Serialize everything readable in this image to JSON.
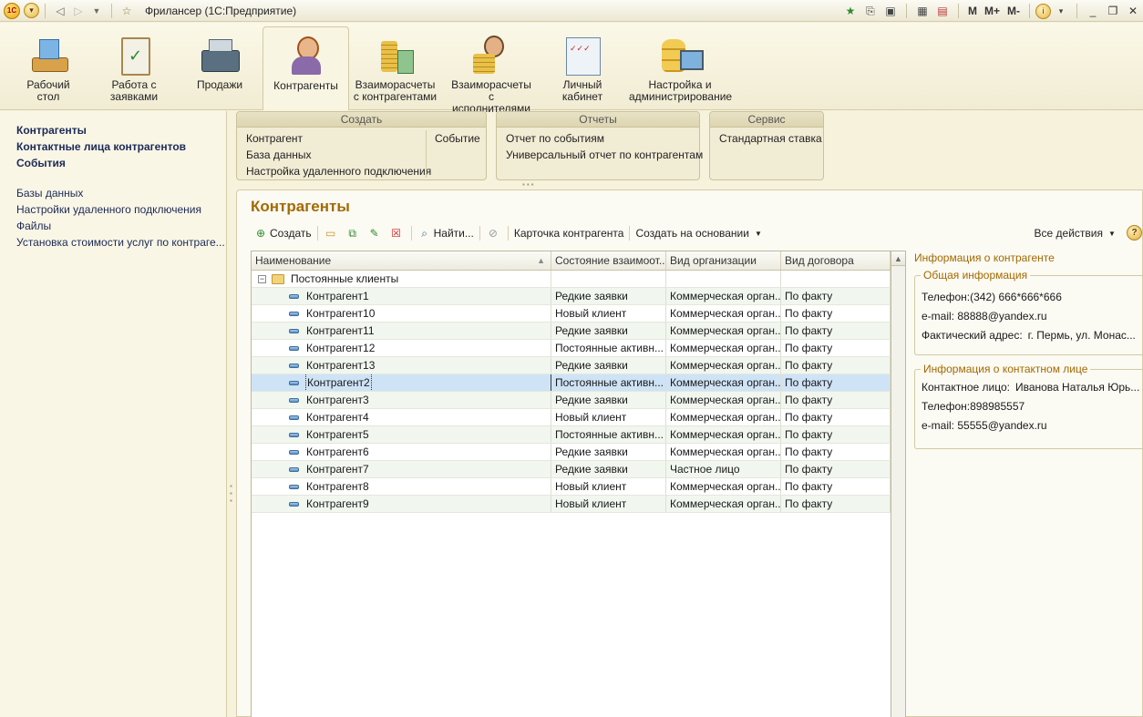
{
  "window": {
    "title": "Фрилансер  (1С:Предприятие)",
    "logo_text": "1С",
    "memory_buttons": [
      "M",
      "M+",
      "M-"
    ]
  },
  "sections": [
    {
      "label_line1": "Рабочий",
      "label_line2": "стол",
      "icon": "desktop-icon"
    },
    {
      "label_line1": "Работа с",
      "label_line2": "заявками",
      "icon": "clipboard-icon"
    },
    {
      "label_line1": "Продажи",
      "label_line2": "",
      "icon": "cash-register-icon"
    },
    {
      "label_line1": "Контрагенты",
      "label_line2": "",
      "icon": "person-icon"
    },
    {
      "label_line1": "Взаиморасчеты",
      "label_line2": "с контрагентами",
      "icon": "coins-icon"
    },
    {
      "label_line1": "Взаиморасчеты",
      "label_line2": "с исполнителями",
      "icon": "worker-icon"
    },
    {
      "label_line1": "Личный",
      "label_line2": "кабинет",
      "icon": "cabinet-icon"
    },
    {
      "label_line1": "Настройка и",
      "label_line2": "администрирование",
      "icon": "database-icon"
    }
  ],
  "leftnav": {
    "main": [
      "Контрагенты",
      "Контактные лица контрагентов",
      "События"
    ],
    "secondary": [
      "Базы данных",
      "Настройки удаленного подключения",
      "Файлы",
      "Установка стоимости услуг по контраге..."
    ]
  },
  "actions": {
    "create": {
      "title": "Создать",
      "items": [
        "Контрагент",
        "База данных",
        "Настройка удаленного подключения"
      ],
      "side_item": "Событие"
    },
    "reports": {
      "title": "Отчеты",
      "items": [
        "Отчет по событиям",
        "Универсальный отчет по контрагентам"
      ]
    },
    "service": {
      "title": "Сервис",
      "items": [
        "Стандартная ставка"
      ]
    }
  },
  "form": {
    "title": "Контрагенты",
    "toolbar": {
      "create": "Создать",
      "find": "Найти...",
      "card": "Карточка контрагента",
      "create_based": "Создать на основании",
      "all_actions": "Все действия",
      "help": "?"
    },
    "table": {
      "columns": [
        "Наименование",
        "Состояние взаимоот...",
        "Вид организации",
        "Вид договора"
      ],
      "group": "Постоянные клиенты",
      "rows": [
        {
          "name": "Контрагент1",
          "state": "Редкие заявки",
          "org": "Коммерческая орган...",
          "contract": "По факту"
        },
        {
          "name": "Контрагент10",
          "state": "Новый клиент",
          "org": "Коммерческая орган...",
          "contract": "По факту"
        },
        {
          "name": "Контрагент11",
          "state": "Редкие заявки",
          "org": "Коммерческая орган...",
          "contract": "По факту"
        },
        {
          "name": "Контрагент12",
          "state": "Постоянные активн...",
          "org": "Коммерческая орган...",
          "contract": "По факту"
        },
        {
          "name": "Контрагент13",
          "state": "Редкие заявки",
          "org": "Коммерческая орган...",
          "contract": "По факту"
        },
        {
          "name": "Контрагент2",
          "state": "Постоянные активн...",
          "org": "Коммерческая орган...",
          "contract": "По факту"
        },
        {
          "name": "Контрагент3",
          "state": "Редкие заявки",
          "org": "Коммерческая орган...",
          "contract": "По факту"
        },
        {
          "name": "Контрагент4",
          "state": "Новый клиент",
          "org": "Коммерческая орган...",
          "contract": "По факту"
        },
        {
          "name": "Контрагент5",
          "state": "Постоянные активн...",
          "org": "Коммерческая орган...",
          "contract": "По факту"
        },
        {
          "name": "Контрагент6",
          "state": "Редкие заявки",
          "org": "Коммерческая орган...",
          "contract": "По факту"
        },
        {
          "name": "Контрагент7",
          "state": "Редкие заявки",
          "org": "Частное лицо",
          "contract": "По факту"
        },
        {
          "name": "Контрагент8",
          "state": "Новый клиент",
          "org": "Коммерческая орган...",
          "contract": "По факту"
        },
        {
          "name": "Контрагент9",
          "state": "Новый клиент",
          "org": "Коммерческая орган...",
          "contract": "По факту"
        }
      ],
      "selected_row": "Контрагент2"
    },
    "info": {
      "title": "Информация о контрагенте",
      "general_title": "Общая информация",
      "phone": "Телефон:(342) 666*666*666",
      "email": "e-mail: 88888@yandex.ru",
      "address_label": "Фактический адрес:",
      "address_value": "г. Пермь, ул. Монас...",
      "contact_title": "Информация о контактном лице",
      "contact_label": "Контактное лицо:",
      "contact_value": "Иванова Наталья Юрь...",
      "contact_phone": "Телефон:898985557",
      "contact_email": "e-mail: 55555@yandex.ru"
    }
  },
  "colors": {
    "accent_title": "#a36a00",
    "link": "#1c2a55",
    "selected_row": "#cfe3f6",
    "alt_row": "#f1f7ef"
  }
}
